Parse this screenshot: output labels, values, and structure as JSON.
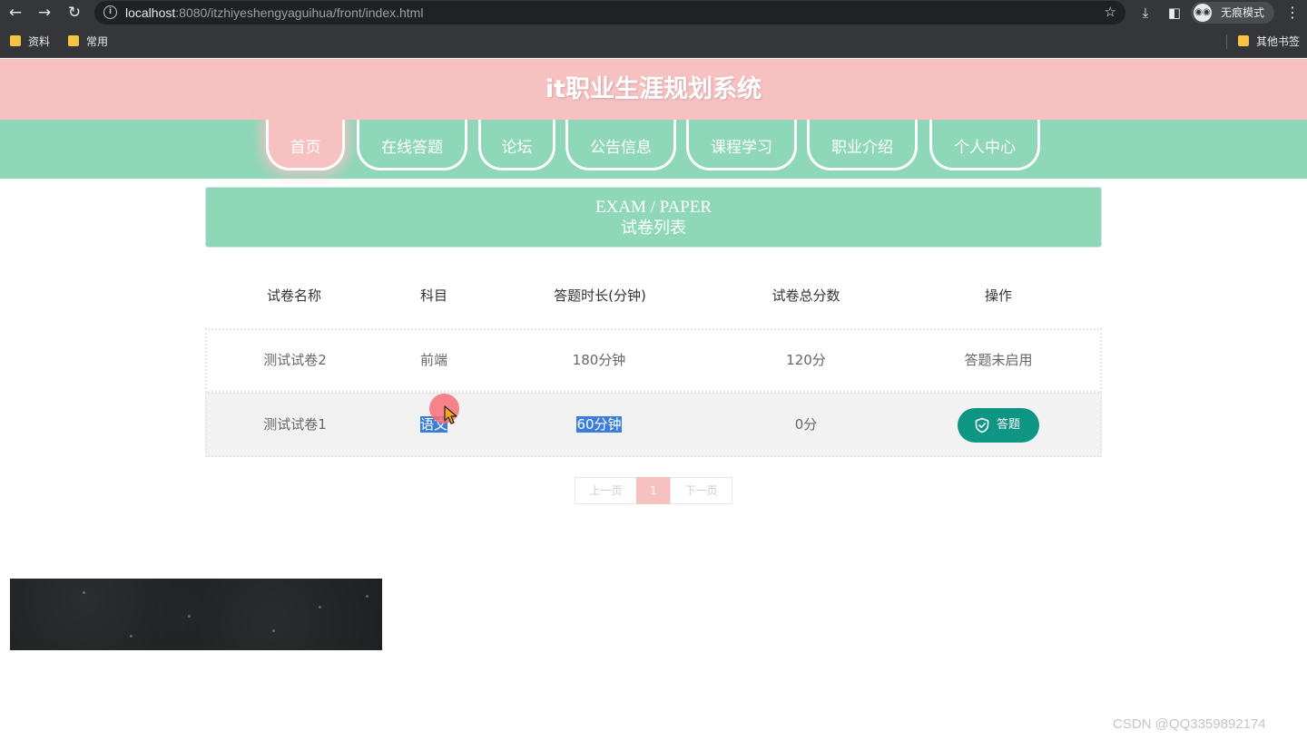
{
  "browser": {
    "url_host": "localhost",
    "url_rest": ":8080/itzhiyeshengyaguihua/front/index.html",
    "incognito_label": "无痕模式",
    "bookmarks": [
      "资料",
      "常用"
    ],
    "other_bookmarks": "其他书签",
    "icons": [
      "back-arrow-icon",
      "forward-arrow-icon",
      "reload-icon",
      "info-icon",
      "star-icon",
      "download-icon",
      "side-panel-icon",
      "incognito-icon",
      "more-menu-icon",
      "folder-icon"
    ]
  },
  "site": {
    "title": "it职业生涯规划系统",
    "nav": [
      "首页",
      "在线答题",
      "论坛",
      "公告信息",
      "课程学习",
      "职业介绍",
      "个人中心"
    ],
    "active_nav": "首页"
  },
  "banner": {
    "en": "EXAM / PAPER",
    "cn": "试卷列表"
  },
  "table": {
    "headers": [
      "试卷名称",
      "科目",
      "答题时长(分钟)",
      "试卷总分数",
      "操作"
    ],
    "rows": [
      {
        "name": "测试试卷2",
        "subject": "前端",
        "duration": "180分钟",
        "score": "120分",
        "action": "答题未启用"
      },
      {
        "name": "测试试卷1",
        "subject": "语文",
        "duration": "60分钟",
        "score": "0分",
        "action": "答题"
      }
    ]
  },
  "pagination": {
    "prev": "上一页",
    "current": "1",
    "next": "下一页"
  },
  "colors": {
    "header_pink": "#f7c1c1",
    "nav_green": "#8fd7b9",
    "button_teal": "#0f9584"
  },
  "watermark": "CSDN @QQ3359892174"
}
